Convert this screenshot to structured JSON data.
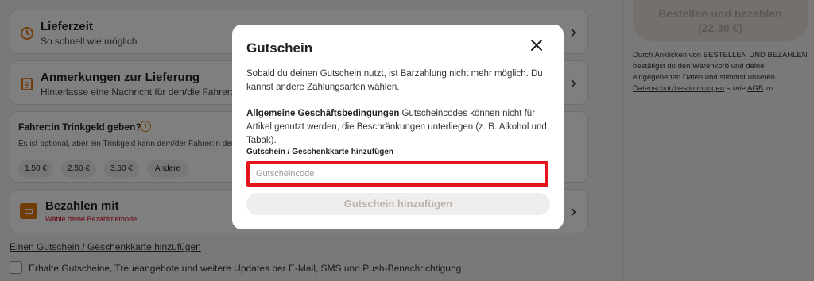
{
  "delivery_time": {
    "title": "Lieferzeit",
    "subtitle": "So schnell wie möglich"
  },
  "delivery_notes": {
    "title": "Anmerkungen zur Lieferung",
    "subtitle": "Hinterlasse eine Nachricht für den/die Fahrer:in"
  },
  "tip": {
    "title": "Fahrer:in Trinkgeld geben?",
    "subtitle": "Es ist optional, aber ein Trinkgeld kann dem/der Fahrer:in den T",
    "options": [
      "1,50 €",
      "2,50 €",
      "3,50 €",
      "Andere"
    ]
  },
  "payment": {
    "title": "Bezahlen mit",
    "subtitle": "Wähle deine Bezahlmethode"
  },
  "voucher_link": "Einen Gutschein / Geschenkkarte hinzufügen",
  "newsletter_checkbox": {
    "label": "Erhalte Gutscheine, Treueangebote und weitere Updates per E-Mail, SMS und Push-Benachrichtigung",
    "checked": false
  },
  "order_button": {
    "label": "Bestellen und bezahlen",
    "amount": "(22,30 €)"
  },
  "terms": {
    "text_before": "Durch Anklicken von BESTELLEN UND BEZAHLEN bestätigst du den Warenkorb und deine eingegebenen Daten und stimmst unseren ",
    "privacy_link": "Datenschutzbestimmungen",
    "middle": " sowie ",
    "agb_link": "AGB",
    "after": " zu."
  },
  "modal": {
    "title": "Gutschein",
    "info_text": "Sobald du deinen Gutschein nutzt, ist Barzahlung nicht mehr möglich. Du kannst andere Zahlungsarten wählen.",
    "terms_heading": "Allgemeine Geschäftsbedingungen",
    "terms_text": " Gutscheincodes können nicht für Artikel genutzt werden, die Beschränkungen unterliegen (z. B. Alkohol und Tabak).",
    "field_label": "Gutschein / Geschenkkarte hinzufügen",
    "input_placeholder": "Gutscheincode",
    "input_value": "",
    "submit_label": "Gutschein hinzufügen"
  },
  "colors": {
    "accent": "#e07a10",
    "highlight": "#e5131c",
    "disabled_text": "#b9b3ad",
    "error_text": "#d0021b"
  }
}
